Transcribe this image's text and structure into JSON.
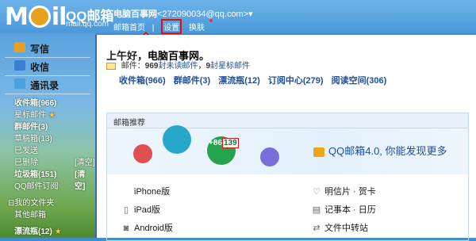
{
  "app": {
    "logo_word": "M",
    "logo_word2": "il",
    "logo_cn": "QQ邮箱",
    "logo_domain": "mail.qq.com"
  },
  "header": {
    "account_name": "电脑百事网",
    "account_email": "<272090034@qq.com>",
    "caret": "▾",
    "links": {
      "home": "邮箱首页",
      "sep": "|",
      "settings": "设置",
      "skin": "换肤"
    }
  },
  "sidebar": {
    "quick": [
      {
        "label": "写信",
        "icon": "write-icon",
        "color": "#e5a021"
      },
      {
        "label": "收信",
        "icon": "inbox-icon",
        "color": "#3b7fd0"
      },
      {
        "label": "通讯录",
        "icon": "contacts-icon",
        "color": "#4aa0e0"
      }
    ],
    "folders": [
      {
        "label": "收件箱(966)",
        "bold": true,
        "extra": ""
      },
      {
        "label": "星标邮件",
        "bold": false,
        "extra": "",
        "star": "★"
      },
      {
        "label": "群邮件(3)",
        "bold": true,
        "extra": ""
      },
      {
        "label": "草稿箱(13)",
        "bold": false,
        "extra": ""
      },
      {
        "label": "已发送",
        "bold": false,
        "extra": ""
      },
      {
        "label": "已删除",
        "bold": false,
        "extra": "[清空]"
      },
      {
        "label": "垃圾箱(151)",
        "bold": true,
        "extra": "[清空]"
      },
      {
        "label": "QQ邮件订阅",
        "bold": false,
        "extra": ""
      }
    ],
    "group_label": "我的文件夹",
    "group_item": "其他邮箱",
    "bottle": "漂流瓶(12)",
    "bottle_star": "★"
  },
  "main": {
    "greeting": "上午好，",
    "greeting_name": "电脑百事网",
    "greeting_end": "。",
    "mail_info": {
      "prefix": "邮件：",
      "unread_count": "969",
      "unread_label": "封未读邮件",
      "sep": "，",
      "star_count": "9",
      "star_label": "封星标邮件"
    },
    "folder_links": [
      "收件箱(966)",
      "群邮件(3)",
      "漂流瓶(12)",
      "订阅中心(279)",
      "阅读空间(306)"
    ],
    "recommend": {
      "title": "邮箱推荐",
      "badge_prefix": "+86",
      "badge_highlight": "139",
      "promo": "QQ邮箱4.0, 你能发现更多",
      "apps_left": [
        {
          "label": "iPhone版",
          "icon": "apple-icon",
          "glyph": ""
        },
        {
          "label": "iPad版",
          "icon": "tablet-icon",
          "glyph": "▯"
        },
        {
          "label": "Android版",
          "icon": "android-icon",
          "glyph": "◙"
        }
      ],
      "apps_right": [
        {
          "label": "明信片 · 贺卡",
          "icon": "heart-icon",
          "glyph": "♡"
        },
        {
          "label": "记事本 · 日历",
          "icon": "notebook-icon",
          "glyph": "▤"
        },
        {
          "label": "文件中转站",
          "icon": "transfer-icon",
          "glyph": "⇄"
        }
      ]
    }
  }
}
